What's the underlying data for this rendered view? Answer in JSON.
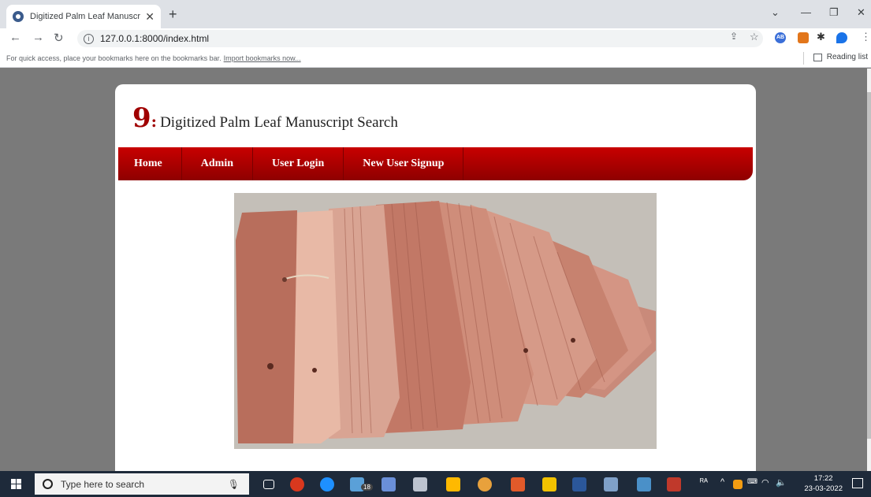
{
  "browser": {
    "tab_title": "Digitized Palm Leaf Manuscript S",
    "tab_close": "✕",
    "new_tab": "+",
    "url": "127.0.0.1:8000/index.html",
    "bookmarks_text": "For quick access, place your bookmarks here on the bookmarks bar.",
    "bookmarks_link": "Import bookmarks now...",
    "reading_list": "Reading list",
    "ext_badge": "AB"
  },
  "site": {
    "logo_mark": "9",
    "title": "Digitized Palm Leaf Manuscript Search",
    "menu": [
      "Home",
      "Admin",
      "User Login",
      "New User Signup"
    ]
  },
  "taskbar": {
    "search_placeholder": "Type here to search",
    "time": "17:22",
    "date": "23-03-2022",
    "badge_count": "18"
  }
}
